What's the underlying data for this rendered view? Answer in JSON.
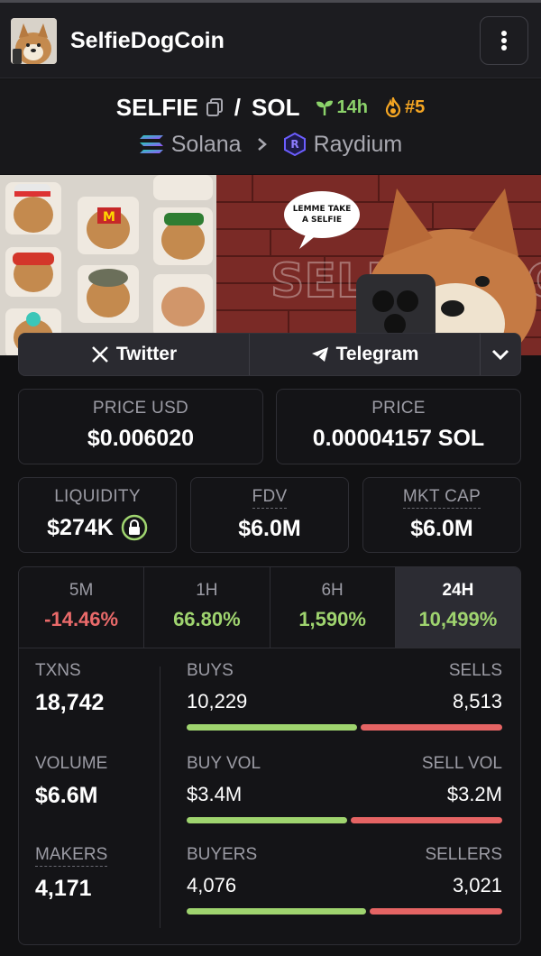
{
  "header": {
    "title": "SelfieDogCoin",
    "menu_icon": "kebab-menu-icon"
  },
  "pair": {
    "base": "SELFIE",
    "quote": "SOL",
    "age": "14h",
    "rank": "#5",
    "chain": "Solana",
    "dex": "Raydium"
  },
  "banner": {
    "speech": "LEMME TAKE A SELFIE",
    "wall_text": "SELFIEDOG"
  },
  "social": {
    "twitter": "Twitter",
    "telegram": "Telegram"
  },
  "prices": {
    "usd_label": "PRICE USD",
    "usd_value": "$0.006020",
    "native_label": "PRICE",
    "native_value": "0.00004157 SOL"
  },
  "metrics": {
    "liquidity_label": "LIQUIDITY",
    "liquidity_value": "$274K",
    "fdv_label": "FDV",
    "fdv_value": "$6.0M",
    "mcap_label": "MKT CAP",
    "mcap_value": "$6.0M"
  },
  "timeframes": [
    {
      "label": "5M",
      "value": "-14.46%",
      "dir": "neg"
    },
    {
      "label": "1H",
      "value": "66.80%",
      "dir": "pos"
    },
    {
      "label": "6H",
      "value": "1,590%",
      "dir": "pos"
    },
    {
      "label": "24H",
      "value": "10,499%",
      "dir": "pos",
      "active": true
    }
  ],
  "stats": {
    "txns_label": "TXNS",
    "txns_value": "18,742",
    "buys_label": "BUYS",
    "buys_value": "10,229",
    "sells_label": "SELLS",
    "sells_value": "8,513",
    "volume_label": "VOLUME",
    "volume_value": "$6.6M",
    "buyvol_label": "BUY VOL",
    "buyvol_value": "$3.4M",
    "sellvol_label": "SELL VOL",
    "sellvol_value": "$3.2M",
    "makers_label": "MAKERS",
    "makers_value": "4,171",
    "buyers_label": "BUYERS",
    "buyers_value": "4,076",
    "sellers_label": "SELLERS",
    "sellers_value": "3,021",
    "buy_share": {
      "txns": 0.5458,
      "volume": 0.515,
      "makers": 0.5743
    }
  },
  "colors": {
    "buy": "#9fd46f",
    "sell": "#e56464",
    "age": "#8bd26a",
    "rank": "#f5a623"
  }
}
